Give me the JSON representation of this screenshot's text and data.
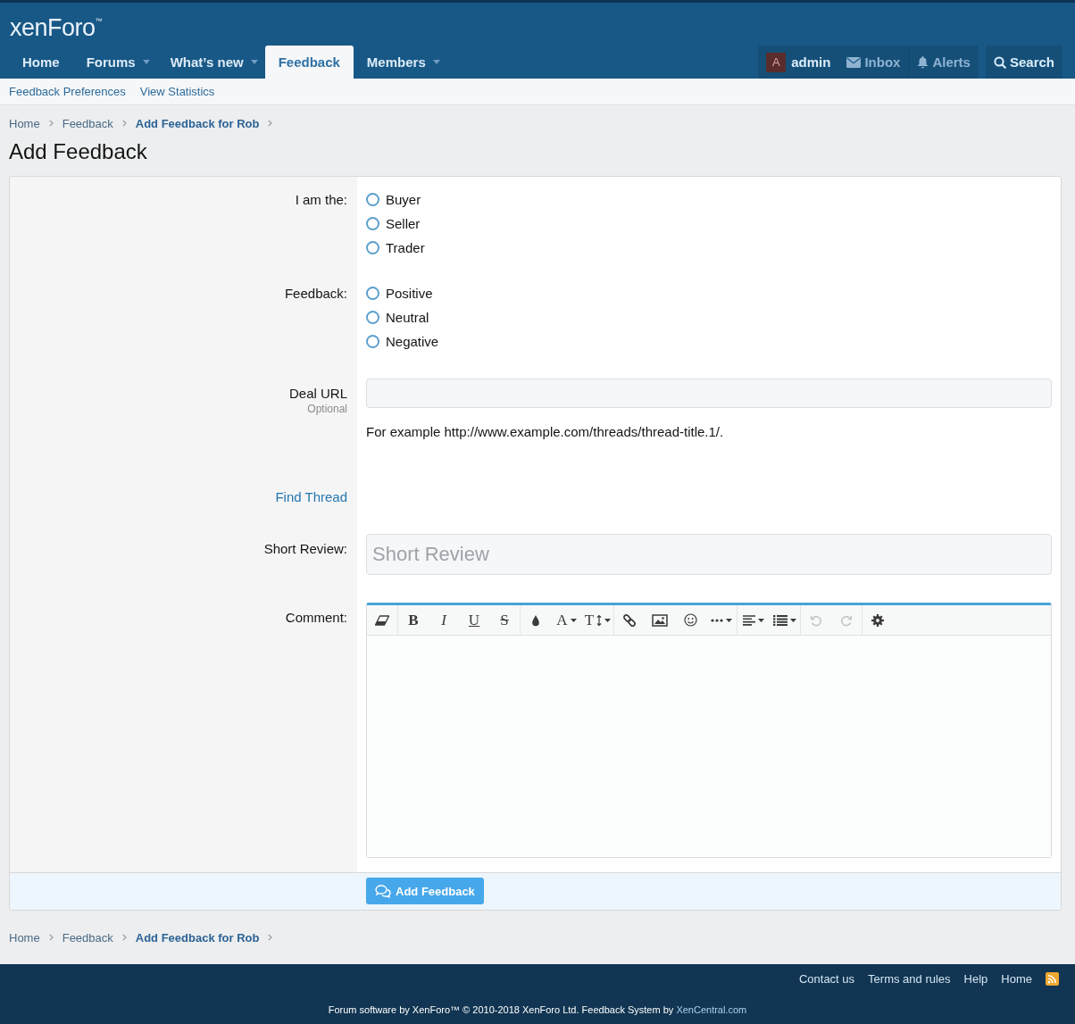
{
  "header": {
    "logo": "xenForo$^{™}$",
    "tabs": [
      {
        "label": "Home",
        "dropdown": false,
        "selected": false
      },
      {
        "label": "Forums",
        "dropdown": true,
        "selected": false
      },
      {
        "label": "What’s new",
        "dropdown": true,
        "selected": false
      },
      {
        "label": "Feedback",
        "dropdown": false,
        "selected": true
      },
      {
        "label": "Members",
        "dropdown": true,
        "selected": false
      }
    ],
    "user": {
      "avatar": "A",
      "name": "admin"
    },
    "inbox": "Inbox",
    "alerts": "Alerts",
    "search": "Search"
  },
  "subnav": {
    "links": [
      "Feedback Preferences",
      "View Statistics"
    ]
  },
  "breadcrumbs_top": [
    {
      "label": "Home",
      "current": false
    },
    {
      "label": "Feedback",
      "current": false
    },
    {
      "label": "Add Feedback for Rob",
      "current": true
    }
  ],
  "title": "Add Feedback",
  "form": {
    "rows": [
      {
        "kind": "radio",
        "label": "I am the:",
        "options": [
          {
            "label": "Buyer",
            "selected": false
          },
          {
            "label": "Seller",
            "selected": false
          },
          {
            "label": "Trader",
            "selected": false
          }
        ]
      },
      {
        "kind": "radio",
        "label": "Feedback:",
        "options": [
          {
            "label": "Positive",
            "selected": false
          },
          {
            "label": "Neutral",
            "selected": false
          },
          {
            "label": "Negative",
            "selected": false
          }
        ]
      },
      {
        "kind": "url",
        "label": "Deal URL",
        "hint": "Optional",
        "explain": "For example http://www.example.com/threads/thread-title.1/."
      },
      {
        "kind": "link",
        "label": "Find Thread"
      },
      {
        "kind": "text",
        "label": "Short Review:",
        "placeholder": "Short Review"
      },
      {
        "kind": "editor",
        "label": "Comment:",
        "toolbar": [
          {
            "buttons": [
              {
                "kind": "eraser",
                "dropdown": false,
                "disabled": false
              }
            ]
          },
          {
            "buttons": [
              {
                "kind": "bold",
                "label": "B",
                "dropdown": false,
                "disabled": false
              },
              {
                "kind": "italic",
                "label": "I",
                "dropdown": false,
                "disabled": false
              },
              {
                "kind": "underline",
                "label": "U",
                "dropdown": false,
                "disabled": false
              },
              {
                "kind": "strike",
                "label": "S",
                "dropdown": false,
                "disabled": false
              }
            ]
          },
          {
            "buttons": [
              {
                "kind": "color",
                "dropdown": false,
                "disabled": false
              },
              {
                "kind": "font",
                "label": "A",
                "dropdown": true,
                "disabled": false
              },
              {
                "kind": "size",
                "label": "T",
                "dropdown": true,
                "disabled": false
              }
            ]
          },
          {
            "buttons": [
              {
                "kind": "link",
                "dropdown": false,
                "disabled": false
              },
              {
                "kind": "image",
                "dropdown": false,
                "disabled": false
              },
              {
                "kind": "smiley",
                "dropdown": false,
                "disabled": false
              },
              {
                "kind": "more",
                "dropdown": true,
                "disabled": false
              }
            ]
          },
          {
            "buttons": [
              {
                "kind": "align",
                "dropdown": true,
                "disabled": false
              },
              {
                "kind": "list",
                "dropdown": true,
                "disabled": false
              }
            ]
          },
          {
            "buttons": [
              {
                "kind": "undo",
                "dropdown": false,
                "disabled": true
              },
              {
                "kind": "redo",
                "dropdown": false,
                "disabled": true
              }
            ]
          },
          {
            "buttons": [
              {
                "kind": "settings",
                "dropdown": false,
                "disabled": false
              }
            ]
          }
        ]
      }
    ],
    "submit": "Add Feedback"
  },
  "breadcrumbs_bottom": [
    {
      "label": "Home",
      "current": false
    },
    {
      "label": "Feedback",
      "current": false
    },
    {
      "label": "Add Feedback for Rob",
      "current": true
    }
  ],
  "footer": {
    "links": [
      "Contact us",
      "Terms and rules",
      "Help",
      "Home"
    ],
    "copyright": "Forum software by XenForo™ © 2010-2018 XenForo Ltd. Feedback System by",
    "copyright_link": "XenCentral.com"
  }
}
